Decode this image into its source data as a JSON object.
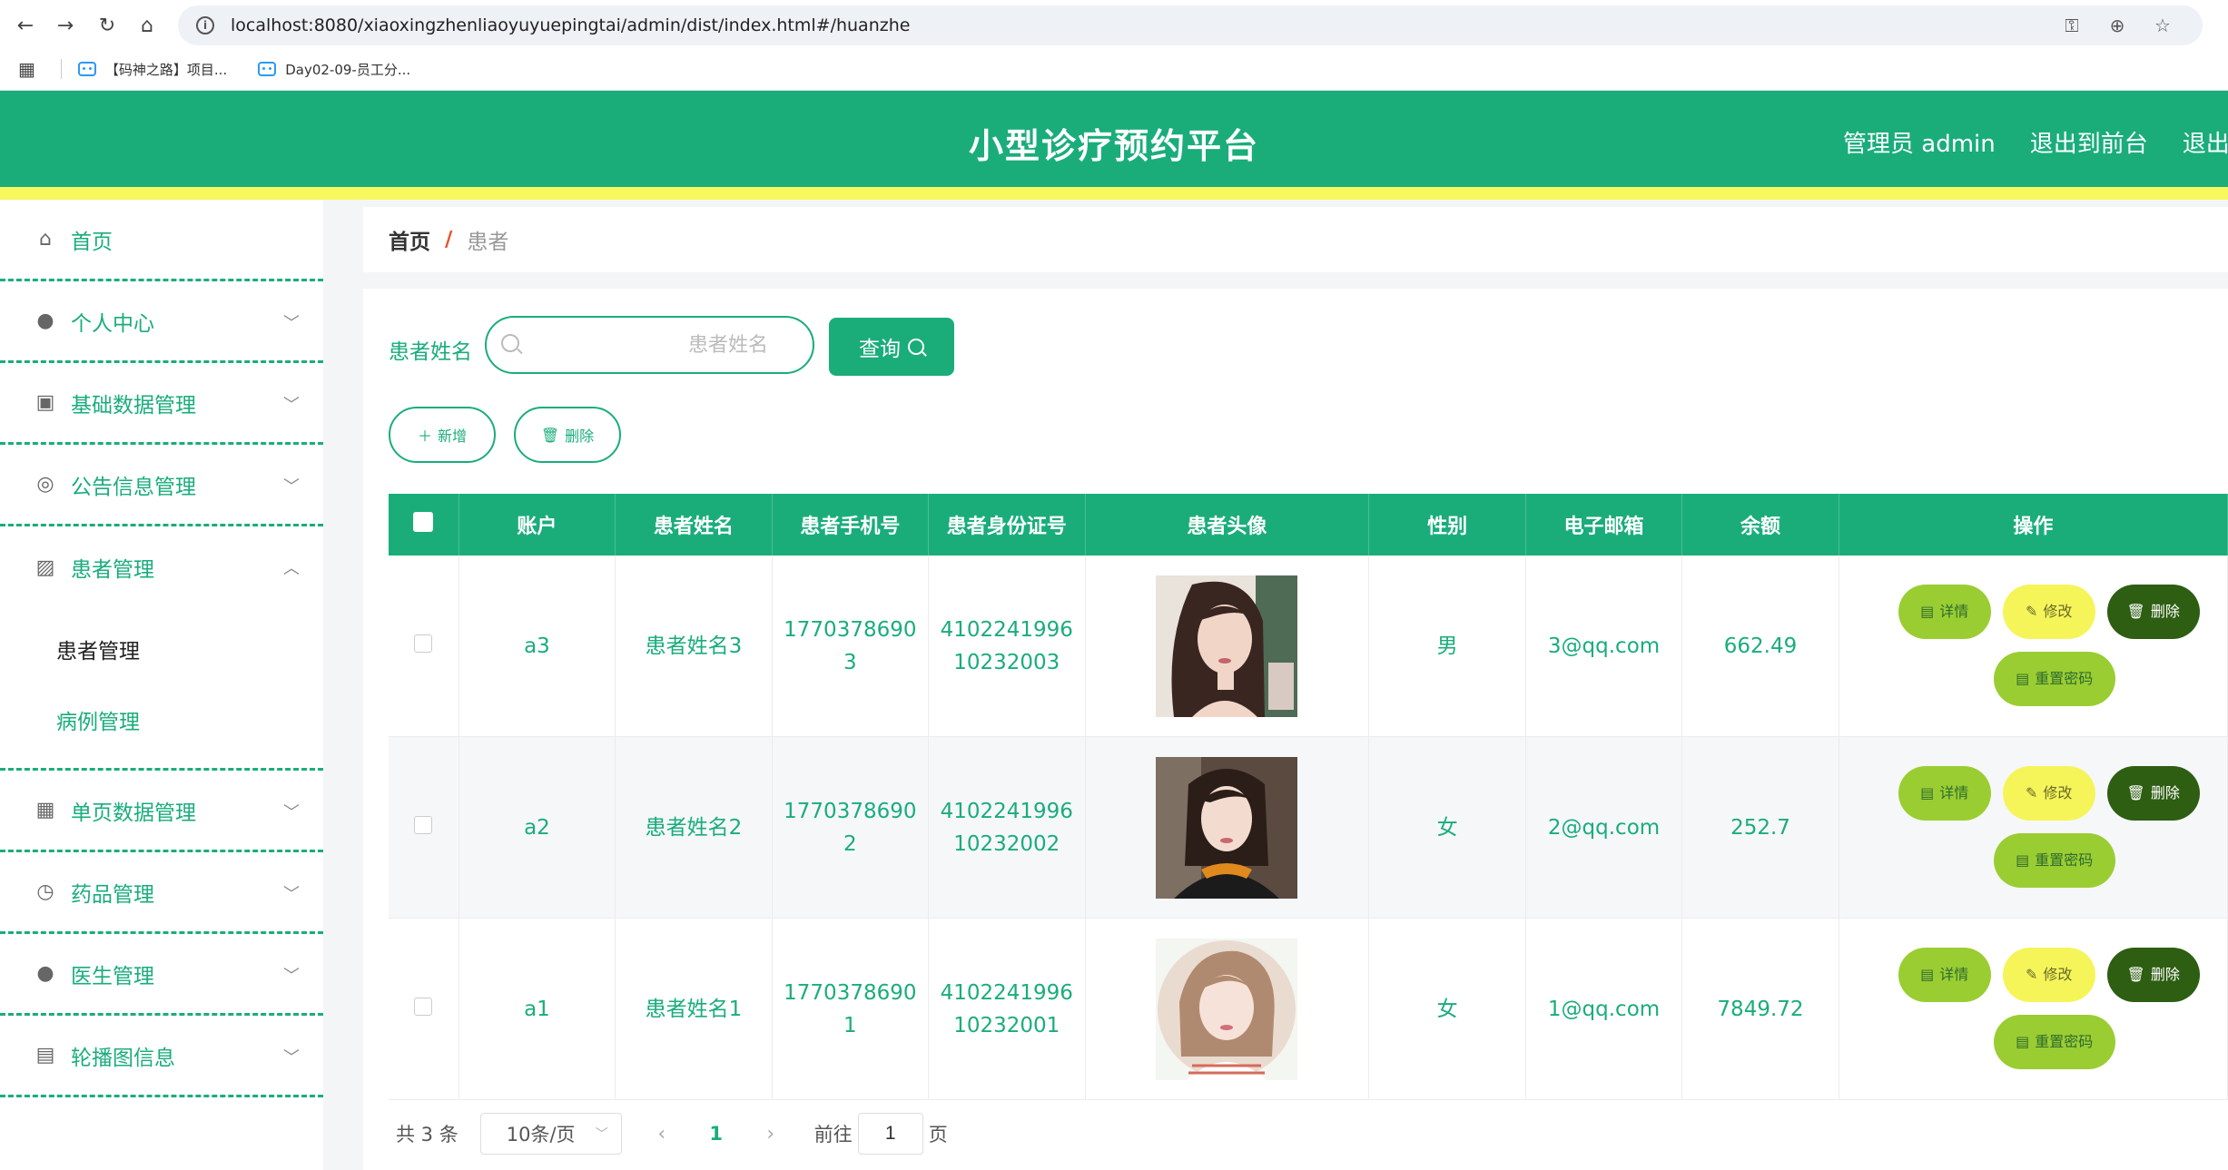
{
  "browser": {
    "url": "localhost:8080/xiaoxingzhenliaoyuyuepingtai/admin/dist/index.html#/huanzhe",
    "bookmarks": [
      "【码神之路】项目...",
      "Day02-09-员工分..."
    ]
  },
  "header": {
    "title": "小型诊疗预约平台",
    "user_label": "管理员 admin",
    "front_link": "退出到前台",
    "logout_link": "退出登录"
  },
  "sidebar": {
    "items": [
      {
        "label": "首页",
        "icon": "home-icon"
      },
      {
        "label": "个人中心",
        "icon": "user-icon"
      },
      {
        "label": "基础数据管理",
        "icon": "clipboard-icon"
      },
      {
        "label": "公告信息管理",
        "icon": "lifebuoy-icon"
      },
      {
        "label": "患者管理",
        "icon": "chart-icon",
        "children": [
          "患者管理",
          "病例管理"
        ]
      },
      {
        "label": "单页数据管理",
        "icon": "grid-icon"
      },
      {
        "label": "药品管理",
        "icon": "clock-icon"
      },
      {
        "label": "医生管理",
        "icon": "doctor-icon"
      },
      {
        "label": "轮播图信息",
        "icon": "carousel-icon"
      }
    ]
  },
  "breadcrumb": {
    "home": "首页",
    "separator": "/",
    "current": "患者"
  },
  "search": {
    "label": "患者姓名",
    "placeholder": "患者姓名",
    "button": "查询"
  },
  "actions": {
    "add": "新增",
    "delete": "删除"
  },
  "table": {
    "columns": [
      "账户",
      "患者姓名",
      "患者手机号",
      "患者身份证号",
      "患者头像",
      "性别",
      "电子邮箱",
      "余额",
      "操作"
    ],
    "rows": [
      {
        "account": "a3",
        "name": "患者姓名3",
        "phone": [
          "1770378690",
          "3"
        ],
        "idcard": [
          "4102241996",
          "10232003"
        ],
        "gender": "男",
        "email": "3@qq.com",
        "balance": "662.49"
      },
      {
        "account": "a2",
        "name": "患者姓名2",
        "phone": [
          "1770378690",
          "2"
        ],
        "idcard": [
          "4102241996",
          "10232002"
        ],
        "gender": "女",
        "email": "2@qq.com",
        "balance": "252.7"
      },
      {
        "account": "a1",
        "name": "患者姓名1",
        "phone": [
          "1770378690",
          "1"
        ],
        "idcard": [
          "4102241996",
          "10232001"
        ],
        "gender": "女",
        "email": "1@qq.com",
        "balance": "7849.72"
      }
    ],
    "ops": {
      "detail": "详情",
      "edit": "修改",
      "delete": "删除",
      "reset": "重置密码"
    }
  },
  "pagination": {
    "total": "共 3 条",
    "page_size": "10条/页",
    "current_page": "1",
    "goto_label": "前往",
    "goto_value": "1",
    "page_unit": "页"
  },
  "colors": {
    "primary": "#1aad7a",
    "accent_stripe": "#f7f75e",
    "op_green": "#9acd32",
    "op_yellow": "#f5f55a",
    "op_dark": "#2d5e12"
  }
}
